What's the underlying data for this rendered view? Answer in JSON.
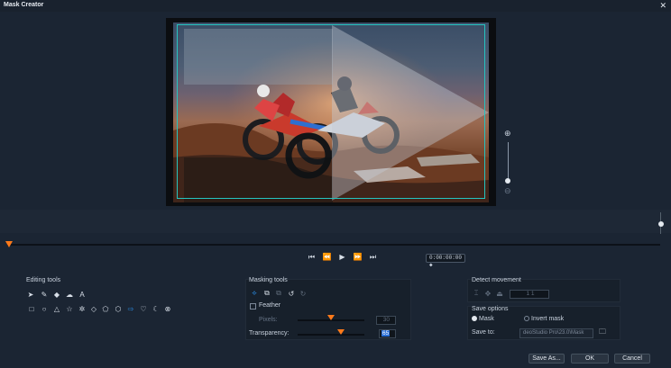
{
  "window": {
    "title": "Mask Creator",
    "close_glyph": "✕"
  },
  "icons": {
    "zoom_in": "zoom-in-icon",
    "zoom_out": "zoom-out-icon"
  },
  "transport": {
    "buttons": [
      "go-to-start",
      "previous-frame",
      "play",
      "next-frame",
      "go-to-end"
    ]
  },
  "timecode": "0:00:00:00 ◆",
  "editing_tools": {
    "title": "Editing tools",
    "row1": [
      "pointer",
      "brush",
      "eraser",
      "lasso",
      "text"
    ],
    "row1_text_glyph": "A",
    "row2": [
      "rectangle",
      "ellipse",
      "triangle",
      "star",
      "gear",
      "diamond",
      "pentagon",
      "hexagon",
      "arrow",
      "heart",
      "crescent",
      "cancel"
    ]
  },
  "masking_tools": {
    "title": "Masking tools",
    "feather_label": "Feather",
    "pixels_label": "Pixels:",
    "pixels_value": "30",
    "transparency_label": "Transparency:",
    "transparency_value": "65"
  },
  "detect_movement": {
    "title": "Detect movement",
    "value": "1  1"
  },
  "save_options": {
    "title": "Save options",
    "mask_label": "Mask",
    "invert_label": "Invert mask",
    "selected": "Mask",
    "save_to_label": "Save to:",
    "save_to_path": "deoStudio Pro\\23.0\\Mask"
  },
  "buttons": {
    "save_as": "Save As...",
    "ok": "OK",
    "cancel": "Cancel"
  },
  "colors": {
    "accent": "#ff7a1a",
    "mask_frame": "#25c4c0",
    "highlight": "#2a8ee8"
  }
}
